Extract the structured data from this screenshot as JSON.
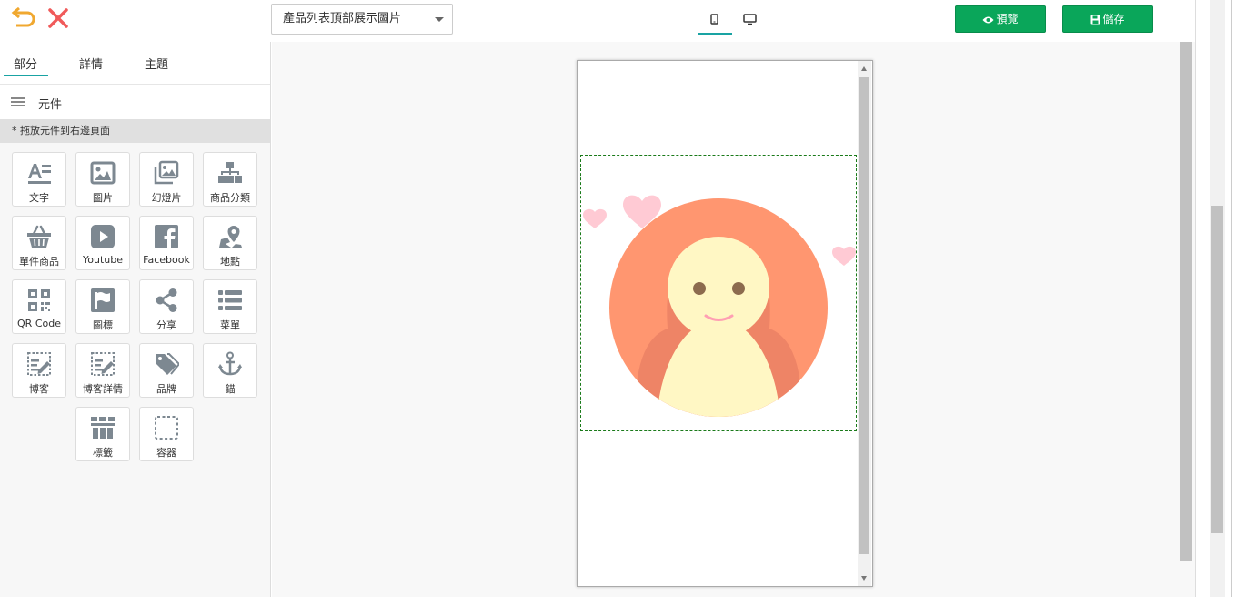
{
  "toolbar": {
    "page_selected": "產品列表頂部展示圖片",
    "preview_label": "預覽",
    "save_label": "儲存"
  },
  "panel": {
    "tabs": [
      {
        "label": "部分",
        "active": true
      },
      {
        "label": "詳情",
        "active": false
      },
      {
        "label": "主題",
        "active": false
      }
    ],
    "section_title": "元件",
    "hint": "* 拖放元件到右邊頁面",
    "components": [
      {
        "label": "文字",
        "icon": "text-icon"
      },
      {
        "label": "圖片",
        "icon": "image-icon"
      },
      {
        "label": "幻燈片",
        "icon": "slideshow-icon"
      },
      {
        "label": "商品分類",
        "icon": "category-icon"
      },
      {
        "label": "單件商品",
        "icon": "basket-icon"
      },
      {
        "label": "Youtube",
        "icon": "youtube-icon"
      },
      {
        "label": "Facebook",
        "icon": "facebook-icon"
      },
      {
        "label": "地點",
        "icon": "map-pin-icon"
      },
      {
        "label": "QR Code",
        "icon": "qr-code-icon"
      },
      {
        "label": "圖標",
        "icon": "flag-icon"
      },
      {
        "label": "分享",
        "icon": "share-icon"
      },
      {
        "label": "菜單",
        "icon": "list-icon"
      },
      {
        "label": "博客",
        "icon": "blog-icon"
      },
      {
        "label": "博客詳情",
        "icon": "blog-detail-icon"
      },
      {
        "label": "品牌",
        "icon": "tags-icon"
      },
      {
        "label": "錨",
        "icon": "anchor-icon"
      },
      {
        "label": "標籤",
        "icon": "tabs-icon"
      },
      {
        "label": "容器",
        "icon": "container-icon"
      }
    ]
  },
  "colors": {
    "accent": "#19a3a3",
    "button_green": "#0aa65a",
    "undo_orange": "#f0a830",
    "close_red": "#f05a5a",
    "icon_gray": "#7d8891",
    "avatar_bg": "#ff9670",
    "avatar_face": "#fff7c4",
    "heart_pink": "#ffcad4"
  }
}
